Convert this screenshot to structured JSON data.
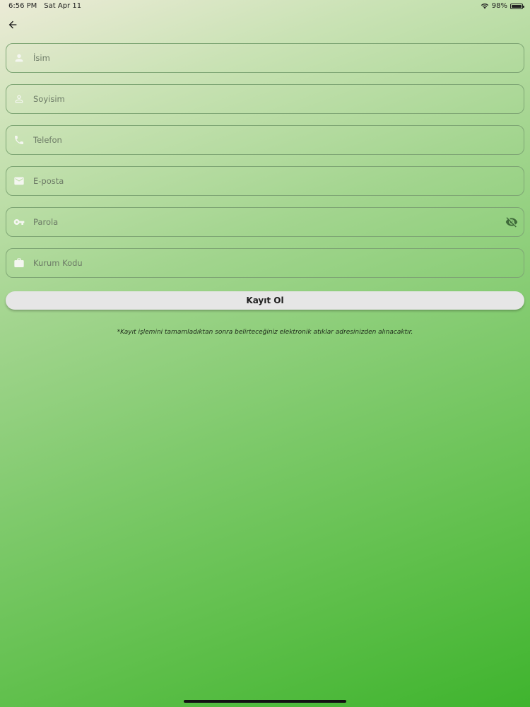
{
  "status_bar": {
    "time": "6:56 PM",
    "date": "Sat Apr 11",
    "battery": "98%"
  },
  "navigation": {
    "back_icon": "arrow-left-icon"
  },
  "form": {
    "fields": [
      {
        "icon": "person-icon",
        "placeholder": "İsim",
        "value": ""
      },
      {
        "icon": "person-outline-icon",
        "placeholder": "Soyisim",
        "value": ""
      },
      {
        "icon": "phone-icon",
        "placeholder": "Telefon",
        "value": ""
      },
      {
        "icon": "mail-icon",
        "placeholder": "E-posta",
        "value": ""
      },
      {
        "icon": "key-icon",
        "placeholder": "Parola",
        "value": "",
        "trailing_icon": "eye-off-icon"
      },
      {
        "icon": "briefcase-icon",
        "placeholder": "Kurum Kodu",
        "value": ""
      }
    ],
    "submit_label": "Kayıt Ol",
    "notice": "*Kayıt işlemini tamamladıktan sonra belirteceğiniz elektronik atıklar adresinizden alınacaktır."
  },
  "colors": {
    "gradient_start": "#ecebd7",
    "gradient_end": "#3fb42e",
    "field_border": "#7fa675",
    "button_bg": "#e6e6e6"
  }
}
